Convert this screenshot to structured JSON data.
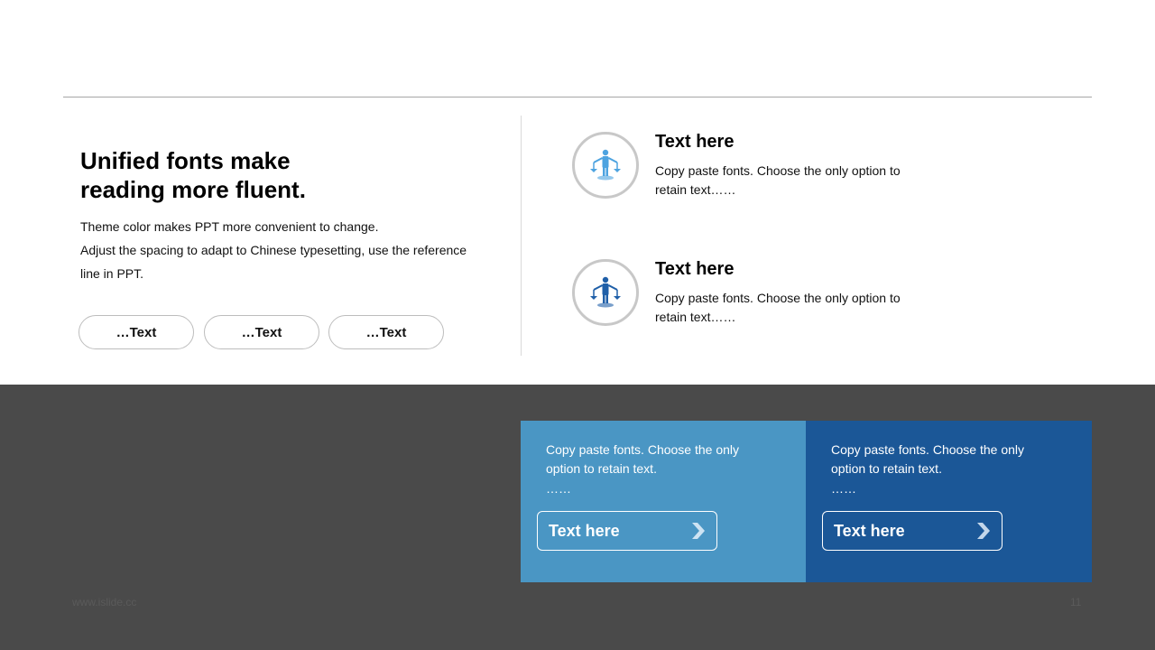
{
  "headline": {
    "line1": "Unified fonts make",
    "line2": "reading more fluent."
  },
  "description": {
    "line1": "Theme color makes PPT more convenient  to change.",
    "line2": "Adjust the spacing to adapt to Chinese typesetting, use the reference line  in PPT."
  },
  "pills": [
    "…Text",
    "…Text",
    "…Text"
  ],
  "features": [
    {
      "icon": "scales-person-icon",
      "title": "Text here",
      "body": "Copy paste fonts. Choose the only option to retain text……",
      "icon_color": "#4da3e0"
    },
    {
      "icon": "scales-person-icon",
      "title": "Text here",
      "body": "Copy paste fonts. Choose the only option to retain text……",
      "icon_color": "#1f5fa8"
    }
  ],
  "cards": [
    {
      "text": "Copy paste fonts. Choose the only option to retain text.",
      "dots": "……",
      "button": "Text here",
      "color": "#4a96c4"
    },
    {
      "text": "Copy paste fonts. Choose the only option to retain text.",
      "dots": "……",
      "button": "Text here",
      "color": "#1b5797"
    }
  ],
  "footer": {
    "url": "www.islide.cc",
    "page": "11"
  },
  "colors": {
    "dark_band": "#4a4a4a",
    "rule": "#a6a6a6"
  }
}
